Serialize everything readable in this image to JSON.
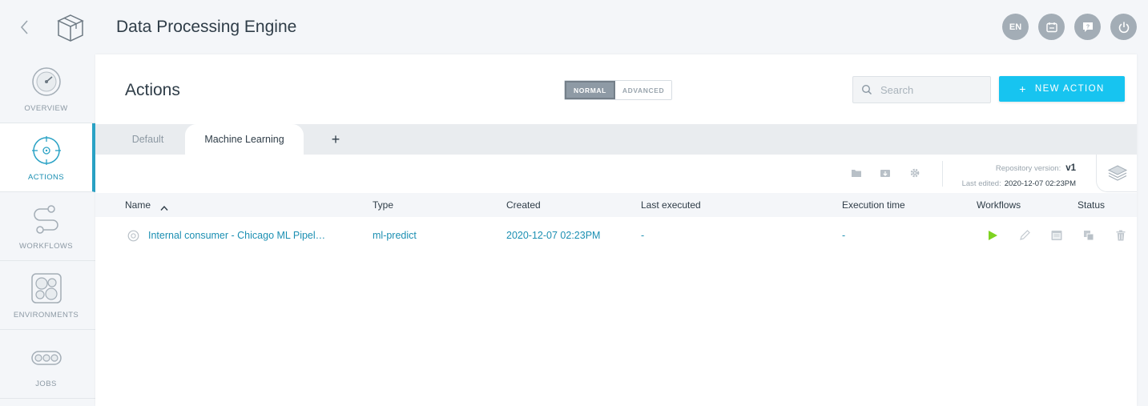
{
  "app": {
    "title": "Data Processing Engine"
  },
  "top_icons": {
    "language": "EN"
  },
  "sidebar": {
    "items": [
      {
        "label": "OVERVIEW"
      },
      {
        "label": "ACTIONS"
      },
      {
        "label": "WORKFLOWS"
      },
      {
        "label": "ENVIRONMENTS"
      },
      {
        "label": "JOBS"
      }
    ]
  },
  "header": {
    "title": "Actions",
    "mode_normal": "NORMAL",
    "mode_advanced": "ADVANCED",
    "search_placeholder": "Search",
    "new_action_label": "NEW ACTION",
    "new_action_plus": "+"
  },
  "tabs": {
    "default": "Default",
    "machine_learning": "Machine Learning",
    "add": "+"
  },
  "repository": {
    "version_label": "Repository version:",
    "version": "v1",
    "edited_label": "Last edited:",
    "edited": "2020-12-07 02:23PM"
  },
  "table": {
    "columns": [
      "Name",
      "Type",
      "Created",
      "Last executed",
      "Execution time",
      "Workflows",
      "Status"
    ],
    "rows": [
      {
        "name": "Internal consumer - Chicago ML Pipel…",
        "type": "ml-predict",
        "created": "2020-12-07 02:23PM",
        "last_executed": "-",
        "execution_time": "-"
      }
    ]
  },
  "colors": {
    "accent": "#17c4f0",
    "active_tab": "#2aa2c5",
    "link": "#1b8fb2",
    "run": "#7ed321"
  }
}
